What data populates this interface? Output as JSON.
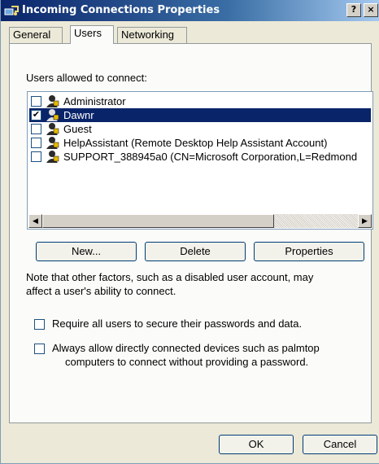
{
  "window": {
    "title": "Incoming Connections Properties",
    "help_button": "?",
    "close_button": "×"
  },
  "tabs": [
    {
      "label": "General",
      "active": false
    },
    {
      "label": "Users",
      "active": true
    },
    {
      "label": "Networking",
      "active": false
    }
  ],
  "users_section": {
    "label": "Users allowed to connect:",
    "users": [
      {
        "name": "Administrator",
        "checked": false,
        "selected": false
      },
      {
        "name": "Dawnr",
        "checked": true,
        "selected": true
      },
      {
        "name": "Guest",
        "checked": false,
        "selected": false
      },
      {
        "name": "HelpAssistant (Remote Desktop Help Assistant Account)",
        "checked": false,
        "selected": false
      },
      {
        "name": "SUPPORT_388945a0 (CN=Microsoft Corporation,L=Redmond",
        "checked": false,
        "selected": false
      }
    ],
    "scroll_left": "◀",
    "scroll_right": "▶"
  },
  "buttons": {
    "new": "New...",
    "delete": "Delete",
    "properties": "Properties"
  },
  "note": {
    "line1": "Note that other factors, such as a disabled user account, may",
    "line2": "affect a user's ability to connect."
  },
  "options": {
    "require_secure": {
      "label": "Require all users to secure their passwords and data.",
      "checked": false
    },
    "allow_devices": {
      "line1": "Always allow directly connected devices such as palmtop",
      "line2": "computers to connect without providing a password.",
      "checked": false
    }
  },
  "footer": {
    "ok": "OK",
    "cancel": "Cancel"
  },
  "colors": {
    "title_bar": "#0a246a",
    "selection": "#0a246a",
    "dialog_bg": "#ece9d8"
  }
}
